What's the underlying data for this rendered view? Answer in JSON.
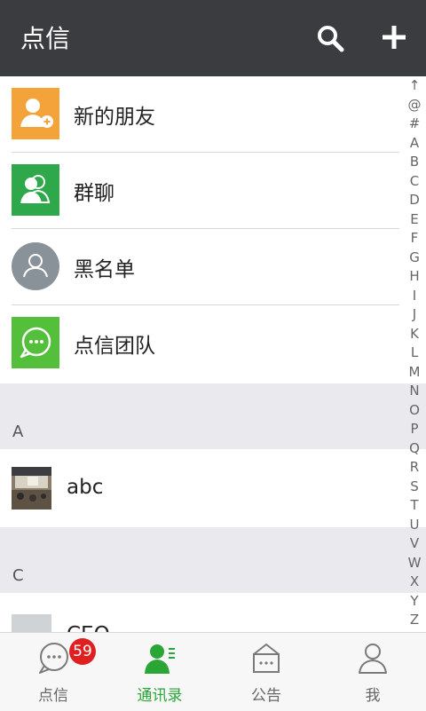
{
  "header": {
    "title": "点信"
  },
  "top_items": [
    {
      "label": "新的朋友",
      "icon": "add-friend-icon",
      "color": "#f4a23a"
    },
    {
      "label": "群聊",
      "icon": "group-chat-icon",
      "color": "#2ea84a"
    },
    {
      "label": "黑名单",
      "icon": "blacklist-user-icon",
      "color": "#8a9299"
    },
    {
      "label": "点信团队",
      "icon": "chat-bubble-icon",
      "color": "#54bf3a"
    }
  ],
  "sections": [
    {
      "letter": "A",
      "contacts": [
        {
          "name": "abc"
        }
      ]
    },
    {
      "letter": "C",
      "contacts": [
        {
          "name": "CEO"
        }
      ]
    }
  ],
  "index_letters": [
    "↑",
    "@",
    "#",
    "A",
    "B",
    "C",
    "D",
    "E",
    "F",
    "G",
    "H",
    "I",
    "J",
    "K",
    "L",
    "M",
    "N",
    "O",
    "P",
    "Q",
    "R",
    "S",
    "T",
    "U",
    "V",
    "W",
    "X",
    "Y",
    "Z"
  ],
  "tabs": [
    {
      "label": "点信",
      "icon": "chat-icon",
      "badge": "59",
      "active": false
    },
    {
      "label": "通讯录",
      "icon": "contacts-icon",
      "active": true
    },
    {
      "label": "公告",
      "icon": "announcement-icon",
      "active": false
    },
    {
      "label": "我",
      "icon": "profile-icon",
      "active": false
    }
  ],
  "colors": {
    "header_bg": "#3a3c40",
    "accent": "#2aa637",
    "badge": "#e02020",
    "section_bg": "#e9e9ee"
  }
}
